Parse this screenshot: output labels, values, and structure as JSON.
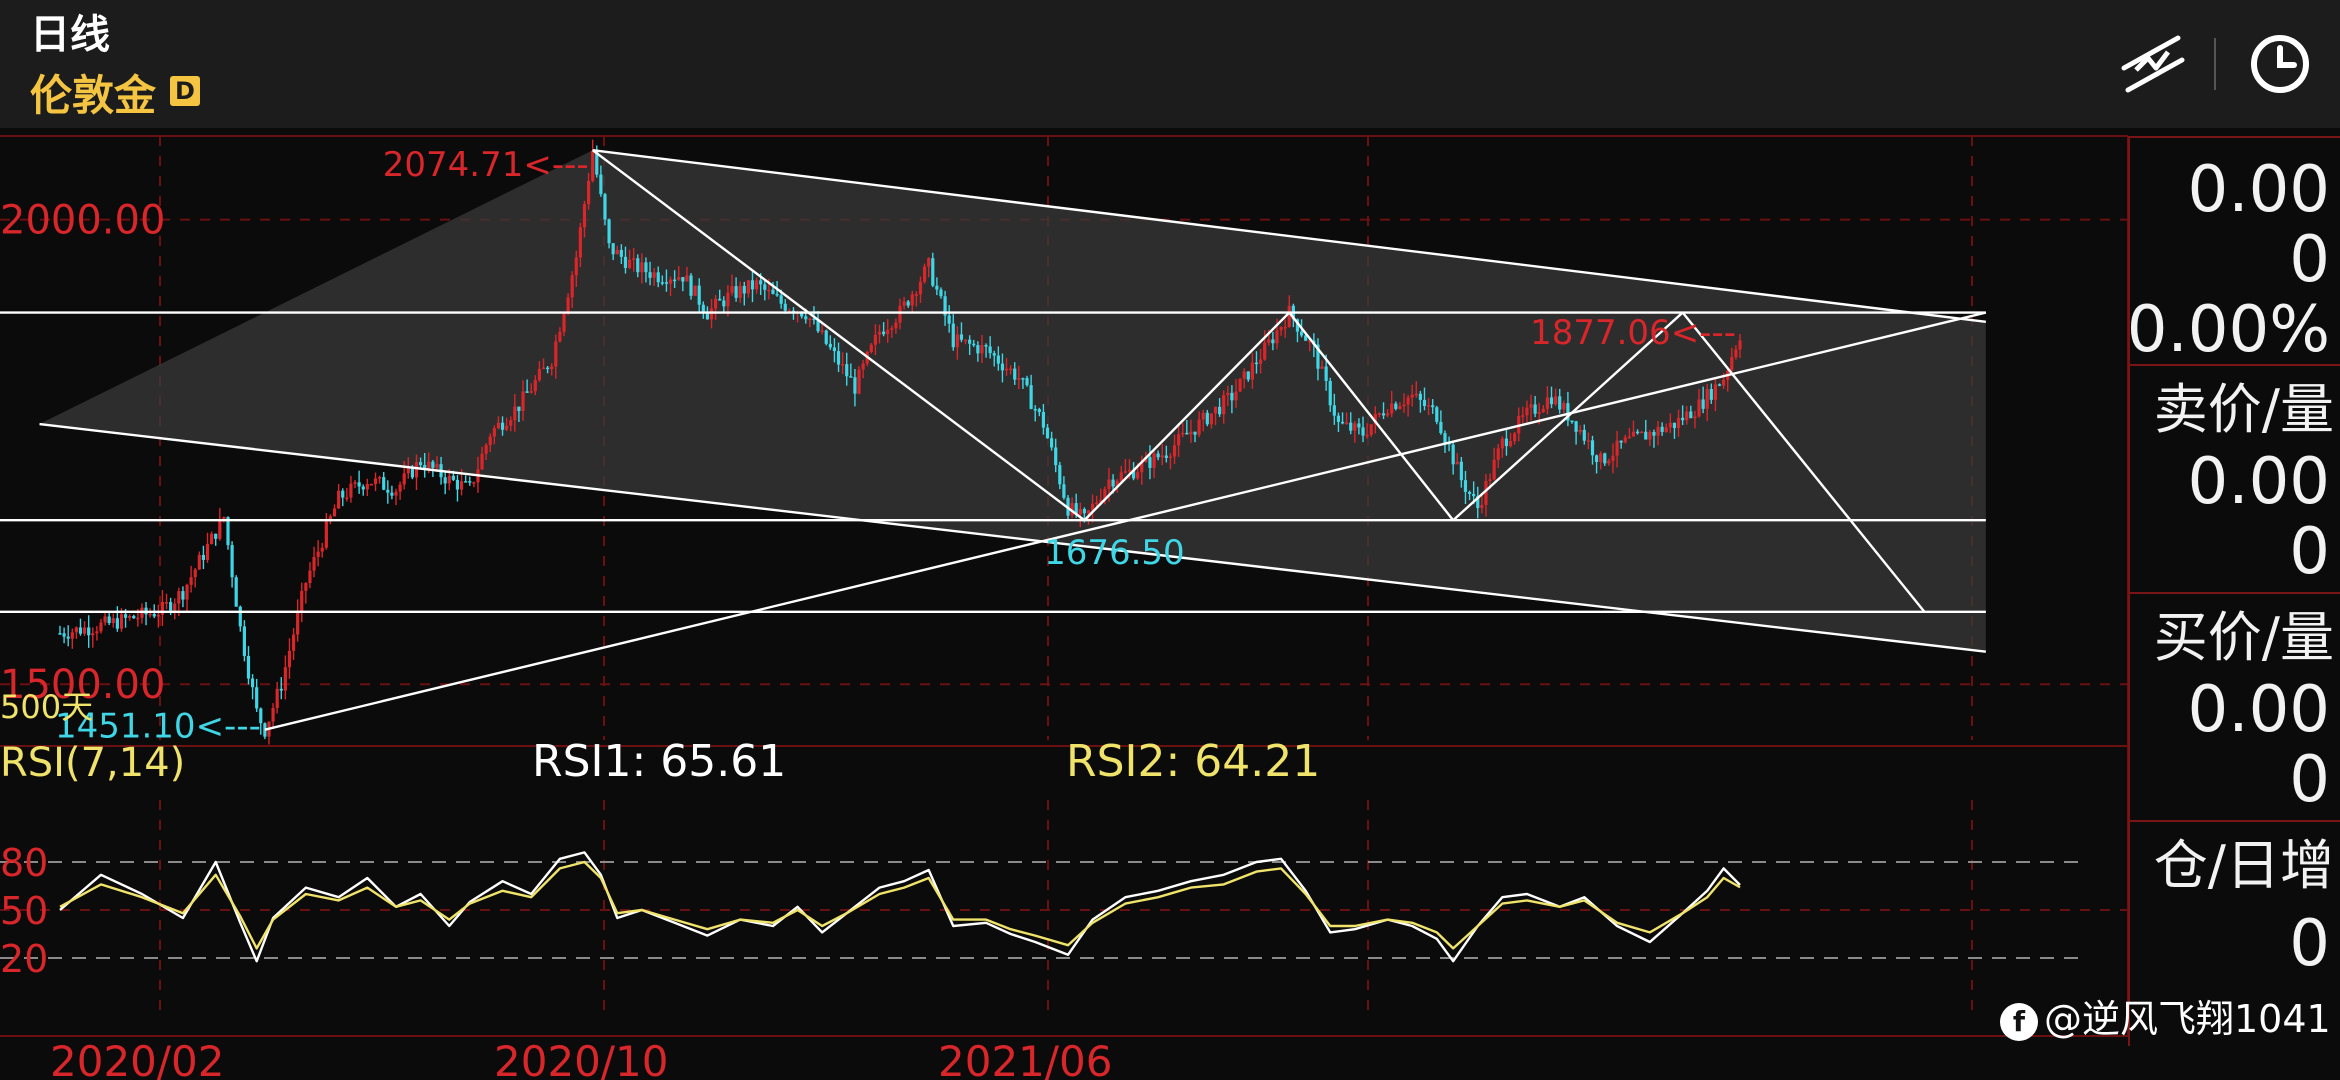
{
  "header": {
    "period": "日线",
    "symbol": "伦敦金",
    "badge": "D"
  },
  "toolbar": {
    "draw_icon": "trendline-draw-icon",
    "time_icon": "clock-icon"
  },
  "side_panel": {
    "top_lines": [
      "0.00",
      "0",
      "0.00%"
    ],
    "ask_label": "卖价/量",
    "ask_lines": [
      "0.00",
      "0"
    ],
    "bid_label": "买价/量",
    "bid_lines": [
      "0.00",
      "0"
    ],
    "oi_label": "仓/日增",
    "oi_lines": [
      "0"
    ]
  },
  "watermark": {
    "logo": "f",
    "text": "@逆风飞翔1041"
  },
  "colors": {
    "up": "#d8262a",
    "down": "#3fd6e6",
    "rsi1": "#ffffff",
    "rsi2": "#f0e36a",
    "grid": "#6a1010"
  },
  "chart_data": {
    "type": "candlestick",
    "period": "D",
    "x_ticks": [
      "2020/02",
      "2020/10",
      "2021/06"
    ],
    "ylim": [
      1440,
      2090
    ],
    "y_ticks": [
      2000.0,
      1500.0
    ],
    "y_tick_labels": [
      "2000.00",
      "1500.00"
    ],
    "range_label": "500天",
    "annotations": [
      {
        "text": "2074.71<---",
        "value": 2074.71,
        "kind": "high"
      },
      {
        "text": "1451.10<---",
        "value": 1451.1,
        "kind": "low"
      },
      {
        "text": "1676.50",
        "value": 1676.5,
        "kind": "swing-low"
      },
      {
        "text": "1877.06<---",
        "value": 1877.06,
        "kind": "last"
      }
    ],
    "price_path": [
      [
        0,
        1555
      ],
      [
        12,
        1565
      ],
      [
        25,
        1580
      ],
      [
        30,
        1600
      ],
      [
        35,
        1640
      ],
      [
        40,
        1680
      ],
      [
        44,
        1560
      ],
      [
        48,
        1470
      ],
      [
        50,
        1451.1
      ],
      [
        54,
        1500
      ],
      [
        60,
        1610
      ],
      [
        68,
        1700
      ],
      [
        75,
        1720
      ],
      [
        82,
        1710
      ],
      [
        88,
        1740
      ],
      [
        95,
        1720
      ],
      [
        100,
        1710
      ],
      [
        105,
        1770
      ],
      [
        112,
        1800
      ],
      [
        120,
        1850
      ],
      [
        126,
        1960
      ],
      [
        130,
        2074.7
      ],
      [
        134,
        1970
      ],
      [
        140,
        1950
      ],
      [
        146,
        1940
      ],
      [
        152,
        1940
      ],
      [
        158,
        1900
      ],
      [
        164,
        1920
      ],
      [
        170,
        1930
      ],
      [
        176,
        1910
      ],
      [
        182,
        1900
      ],
      [
        188,
        1860
      ],
      [
        194,
        1820
      ],
      [
        200,
        1880
      ],
      [
        205,
        1900
      ],
      [
        212,
        1950
      ],
      [
        218,
        1870
      ],
      [
        226,
        1860
      ],
      [
        234,
        1830
      ],
      [
        240,
        1780
      ],
      [
        246,
        1690
      ],
      [
        250,
        1676.5
      ],
      [
        256,
        1720
      ],
      [
        262,
        1730
      ],
      [
        270,
        1750
      ],
      [
        278,
        1780
      ],
      [
        286,
        1810
      ],
      [
        294,
        1860
      ],
      [
        300,
        1900
      ],
      [
        306,
        1860
      ],
      [
        312,
        1780
      ],
      [
        318,
        1770
      ],
      [
        324,
        1800
      ],
      [
        330,
        1810
      ],
      [
        336,
        1790
      ],
      [
        342,
        1720
      ],
      [
        346,
        1690
      ],
      [
        352,
        1760
      ],
      [
        358,
        1790
      ],
      [
        364,
        1810
      ],
      [
        370,
        1780
      ],
      [
        376,
        1740
      ],
      [
        382,
        1760
      ],
      [
        388,
        1770
      ],
      [
        394,
        1780
      ],
      [
        400,
        1800
      ],
      [
        406,
        1830
      ],
      [
        410,
        1877.06
      ]
    ],
    "trendlines": [
      {
        "from": [
          130,
          2074.71
        ],
        "to": [
          470,
          1890
        ]
      },
      {
        "from": [
          -5,
          1780
        ],
        "to": [
          470,
          1535
        ]
      },
      {
        "from": [
          50,
          1451.1
        ],
        "to": [
          470,
          1900
        ]
      },
      {
        "from": [
          130,
          2074.71
        ],
        "to": [
          250,
          1676.5
        ]
      },
      {
        "from": [
          250,
          1676.5
        ],
        "to": [
          300,
          1900
        ]
      },
      {
        "from": [
          300,
          1900
        ],
        "to": [
          340,
          1676.5
        ]
      },
      {
        "from": [
          340,
          1676.5
        ],
        "to": [
          396,
          1900
        ]
      },
      {
        "from": [
          396,
          1900
        ],
        "to": [
          455,
          1578
        ]
      }
    ],
    "hlines": [
      1900,
      1676.5,
      1578
    ],
    "rsi": {
      "label": "RSI(7,14)",
      "rsi1_label": "RSI1: 65.61",
      "rsi2_label": "RSI2: 64.21",
      "ylim": [
        0,
        100
      ],
      "y_ticks": [
        80,
        50,
        20
      ],
      "y_tick_labels": [
        "80",
        "50",
        "20"
      ],
      "rsi1_last": 65.61,
      "rsi2_last": 64.21,
      "rsi1_path": [
        [
          0,
          50
        ],
        [
          10,
          72
        ],
        [
          20,
          60
        ],
        [
          30,
          45
        ],
        [
          38,
          80
        ],
        [
          44,
          42
        ],
        [
          48,
          18
        ],
        [
          52,
          45
        ],
        [
          60,
          64
        ],
        [
          68,
          58
        ],
        [
          75,
          70
        ],
        [
          82,
          52
        ],
        [
          88,
          60
        ],
        [
          95,
          40
        ],
        [
          100,
          55
        ],
        [
          108,
          68
        ],
        [
          115,
          60
        ],
        [
          122,
          82
        ],
        [
          128,
          86
        ],
        [
          132,
          72
        ],
        [
          136,
          45
        ],
        [
          142,
          50
        ],
        [
          150,
          42
        ],
        [
          158,
          34
        ],
        [
          166,
          44
        ],
        [
          174,
          40
        ],
        [
          180,
          52
        ],
        [
          186,
          36
        ],
        [
          192,
          48
        ],
        [
          200,
          64
        ],
        [
          206,
          68
        ],
        [
          212,
          75
        ],
        [
          218,
          40
        ],
        [
          226,
          42
        ],
        [
          232,
          35
        ],
        [
          238,
          30
        ],
        [
          246,
          22
        ],
        [
          252,
          44
        ],
        [
          260,
          58
        ],
        [
          268,
          62
        ],
        [
          276,
          68
        ],
        [
          284,
          72
        ],
        [
          292,
          80
        ],
        [
          298,
          82
        ],
        [
          304,
          62
        ],
        [
          310,
          36
        ],
        [
          316,
          38
        ],
        [
          324,
          44
        ],
        [
          330,
          40
        ],
        [
          336,
          32
        ],
        [
          340,
          18
        ],
        [
          346,
          40
        ],
        [
          352,
          58
        ],
        [
          358,
          60
        ],
        [
          366,
          52
        ],
        [
          372,
          58
        ],
        [
          380,
          40
        ],
        [
          388,
          30
        ],
        [
          396,
          48
        ],
        [
          402,
          62
        ],
        [
          406,
          76
        ],
        [
          410,
          65.61
        ]
      ],
      "rsi2_path": [
        [
          0,
          52
        ],
        [
          10,
          66
        ],
        [
          20,
          58
        ],
        [
          30,
          48
        ],
        [
          38,
          72
        ],
        [
          44,
          46
        ],
        [
          48,
          26
        ],
        [
          52,
          44
        ],
        [
          60,
          60
        ],
        [
          68,
          56
        ],
        [
          75,
          64
        ],
        [
          82,
          52
        ],
        [
          88,
          56
        ],
        [
          95,
          44
        ],
        [
          100,
          54
        ],
        [
          108,
          62
        ],
        [
          115,
          58
        ],
        [
          122,
          76
        ],
        [
          128,
          80
        ],
        [
          132,
          70
        ],
        [
          136,
          48
        ],
        [
          142,
          50
        ],
        [
          150,
          44
        ],
        [
          158,
          38
        ],
        [
          166,
          44
        ],
        [
          174,
          42
        ],
        [
          180,
          50
        ],
        [
          186,
          40
        ],
        [
          192,
          48
        ],
        [
          200,
          60
        ],
        [
          206,
          64
        ],
        [
          212,
          70
        ],
        [
          218,
          44
        ],
        [
          226,
          44
        ],
        [
          232,
          38
        ],
        [
          238,
          34
        ],
        [
          246,
          28
        ],
        [
          252,
          42
        ],
        [
          260,
          54
        ],
        [
          268,
          58
        ],
        [
          276,
          64
        ],
        [
          284,
          66
        ],
        [
          292,
          74
        ],
        [
          298,
          76
        ],
        [
          304,
          60
        ],
        [
          310,
          40
        ],
        [
          316,
          40
        ],
        [
          324,
          44
        ],
        [
          330,
          42
        ],
        [
          336,
          36
        ],
        [
          340,
          26
        ],
        [
          346,
          40
        ],
        [
          352,
          54
        ],
        [
          358,
          56
        ],
        [
          366,
          52
        ],
        [
          372,
          56
        ],
        [
          380,
          42
        ],
        [
          388,
          36
        ],
        [
          396,
          48
        ],
        [
          402,
          58
        ],
        [
          406,
          70
        ],
        [
          410,
          64.21
        ]
      ]
    },
    "grid": true
  }
}
